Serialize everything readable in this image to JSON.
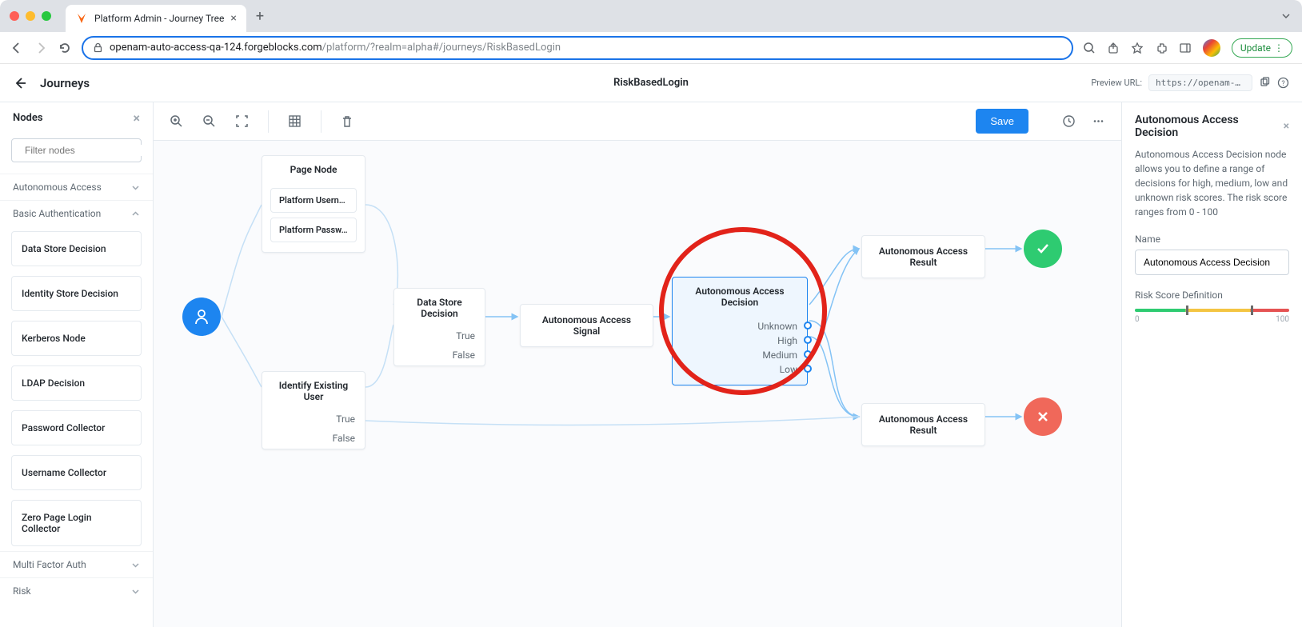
{
  "browser": {
    "tab_title": "Platform Admin - Journey Tree",
    "url_host": "openam-auto-access-qa-124.forgeblocks.com",
    "url_path": "/platform/?realm=alpha#/journeys/RiskBasedLogin",
    "update_label": "Update"
  },
  "header": {
    "title": "Journeys",
    "journey_name": "RiskBasedLogin",
    "preview_label": "Preview URL:",
    "preview_url": "https://openam-auto…"
  },
  "sidebar": {
    "title": "Nodes",
    "filter_placeholder": "Filter nodes",
    "categories": [
      {
        "label": "Autonomous Access",
        "expanded": false
      },
      {
        "label": "Basic Authentication",
        "expanded": true,
        "items": [
          "Data Store Decision",
          "Identity Store Decision",
          "Kerberos Node",
          "LDAP Decision",
          "Password Collector",
          "Username Collector",
          "Zero Page Login Collector"
        ]
      },
      {
        "label": "Multi Factor Auth",
        "expanded": false
      },
      {
        "label": "Risk",
        "expanded": false
      }
    ]
  },
  "toolbar": {
    "save_label": "Save"
  },
  "flow": {
    "page_node": {
      "title": "Page Node",
      "chips": [
        "Platform Usern…",
        "Platform Passw…"
      ]
    },
    "data_store": {
      "title": "Data Store Decision",
      "outcomes": [
        "True",
        "False"
      ]
    },
    "identify_existing": {
      "title": "Identify Existing User",
      "outcomes": [
        "True",
        "False"
      ]
    },
    "signal": {
      "title": "Autonomous Access Signal"
    },
    "decision": {
      "title": "Autonomous Access Decision",
      "outcomes": [
        "Unknown",
        "High",
        "Medium",
        "Low"
      ]
    },
    "result1": {
      "title": "Autonomous Access Result"
    },
    "result2": {
      "title": "Autonomous Access Result"
    }
  },
  "right_panel": {
    "title": "Autonomous Access Decision",
    "description": "Autonomous Access Decision node allows you to define a range of decisions for high, medium, low and unknown risk scores. The risk score ranges from 0 - 100",
    "name_label": "Name",
    "name_value": "Autonomous Access Decision",
    "risk_label": "Risk Score Definition",
    "risk_min": "0",
    "risk_max": "100"
  }
}
